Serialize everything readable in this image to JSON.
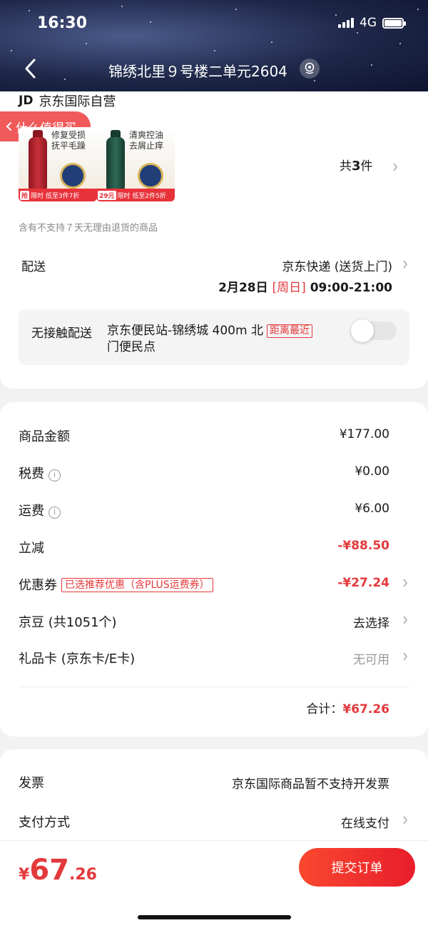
{
  "status_bar": {
    "time": "16:30",
    "network": "4G"
  },
  "header": {
    "address": "锦绣北里９号楼二单元2604"
  },
  "shop": {
    "logo": "JD",
    "name": "京东国际自营"
  },
  "float_tag": {
    "label": "什么值得买"
  },
  "products": [
    {
      "line1": "修复受损",
      "line2": "抚平毛躁",
      "promo_badge": "抢",
      "strip": "限时 低至3件7折",
      "color": "#b0202a"
    },
    {
      "line1": "清爽控油",
      "line2": "去屑止痒",
      "promo_badge": "29元",
      "strip": "限时 低至2件5折",
      "color": "#1d4a3c"
    }
  ],
  "quantity": {
    "prefix": "共",
    "count": "3",
    "suffix": "件"
  },
  "notice": "含有不支持７天无理由退货的商品",
  "delivery": {
    "label": "配送",
    "method": "京东快递 (送货上门)",
    "date": "2月28日",
    "weekday": "[周日]",
    "time_range": "09:00-21:00",
    "contactless_label": "无接触配送",
    "station": "京东便民站-锦绣城 400m 北门便民点",
    "nearest_tag": "距离最近",
    "contactless_enabled": false
  },
  "fees": {
    "goods_label": "商品金额",
    "goods_value": "¥177.00",
    "tax_label": "税费",
    "tax_value": "¥0.00",
    "shipping_label": "运费",
    "shipping_value": "¥6.00",
    "discount_label": "立减",
    "discount_value": "-¥88.50",
    "coupon_label": "优惠券",
    "coupon_tag": "已选推荐优惠（含PLUS运费券）",
    "coupon_value": "-¥27.24",
    "beans_label": "京豆 (共1051个)",
    "beans_value": "去选择",
    "giftcard_label": "礼品卡 (京东卡/E卡)",
    "giftcard_value": "无可用",
    "total_label": "合计：",
    "total_value": "¥67.26"
  },
  "invoice": {
    "label": "发票",
    "value": "京东国际商品暂不支持开发票"
  },
  "payment": {
    "label": "支付方式",
    "value": "在线支付"
  },
  "bottom": {
    "currency": "¥",
    "price_int": "67",
    "price_dec": ".26",
    "submit_label": "提交订单"
  },
  "colors": {
    "accent": "#e4393c",
    "button": "#f03a2e"
  }
}
